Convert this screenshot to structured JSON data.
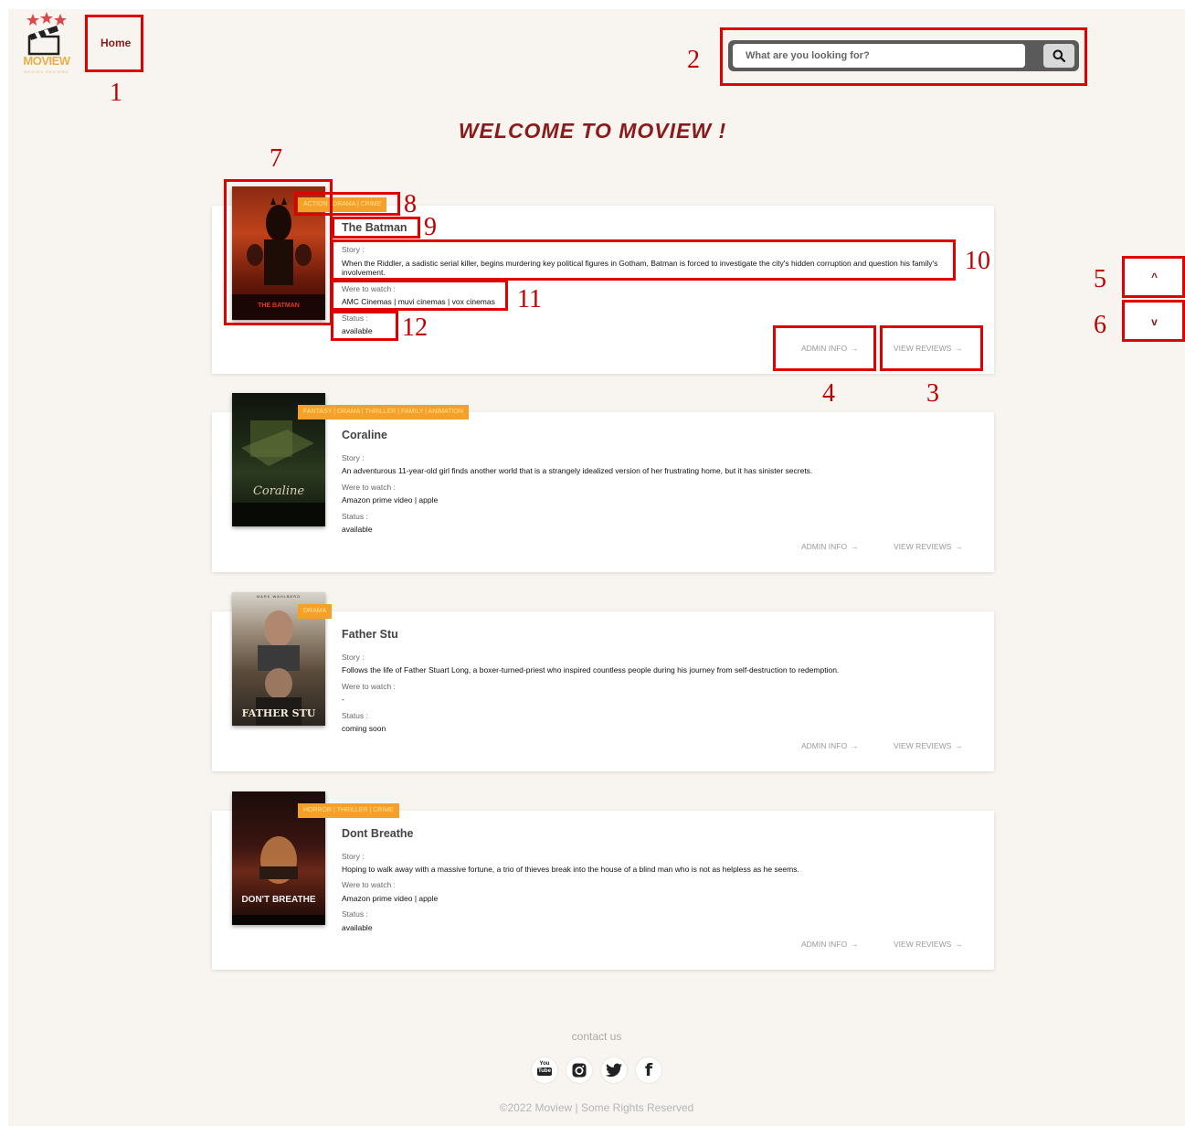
{
  "header": {
    "logo_text": "MOVIEW",
    "logo_subtitle": "MOVIES REVIEWS",
    "nav": {
      "home_label": "Home"
    },
    "search": {
      "placeholder": "What are you looking for?",
      "icon": "search-icon"
    }
  },
  "welcome_title": "WELCOME TO MOVIEW !",
  "labels": {
    "story": "Story :",
    "where": "Were to watch :",
    "status": "Status :"
  },
  "actions": {
    "admin_info": "ADMIN INFO",
    "view_reviews": "VIEW REVIEWS"
  },
  "movies": [
    {
      "title": "The Batman",
      "genres": "ACTION | DRAMA | CRIME",
      "story": "When the Riddler, a sadistic serial killer, begins murdering key political figures in Gotham, Batman is forced to investigate the city's hidden corruption and question his family's involvement.",
      "where_to_watch": "AMC Cinemas | muvi cinemas | vox cinemas",
      "status": "available",
      "poster_caption": "THE BATMAN"
    },
    {
      "title": "Coraline",
      "genres": "FANTASY | DRAMA | THRILLER | FAMILY | ANIMATION",
      "story": "An adventurous 11-year-old girl finds another world that is a strangely idealized version of her frustrating home, but it has sinister secrets.",
      "where_to_watch": "Amazon prime video | apple",
      "status": "available",
      "poster_caption": "Coraline"
    },
    {
      "title": "Father Stu",
      "genres": "DRAMA",
      "story": "Follows the life of Father Stuart Long, a boxer-turned-priest who inspired countless people during his journey from self-destruction to redemption.",
      "where_to_watch": "-",
      "status": "coming soon",
      "poster_caption": "FATHER STU",
      "poster_top": "MARK WAHLBERG"
    },
    {
      "title": "Dont Breathe",
      "genres": "HORROR | THRILLER | CRIME",
      "story": "Hoping to walk away with a massive fortune, a trio of thieves break into the house of a blind man who is not as helpless as he seems.",
      "where_to_watch": "Amazon prime video | apple",
      "status": "available",
      "poster_caption": "DON'T BREATHE"
    }
  ],
  "scroll": {
    "up": "^",
    "down": "v"
  },
  "annotations": [
    "1",
    "2",
    "3",
    "4",
    "5",
    "6",
    "7",
    "8",
    "9",
    "10",
    "11",
    "12"
  ],
  "footer": {
    "contact": "contact us",
    "social_icons": [
      "youtube-icon",
      "instagram-icon",
      "twitter-icon",
      "facebook-icon"
    ],
    "youtube_text_top": "You",
    "youtube_text_bottom": "Tube",
    "facebook_letter": "f",
    "copyright": "©2022 Moview | Some Rights Reserved"
  },
  "colors": {
    "brand": "#8b1a1a",
    "genre_tag": "#f5a02a",
    "background": "#f8f5f0",
    "annotation": "#e00000"
  }
}
